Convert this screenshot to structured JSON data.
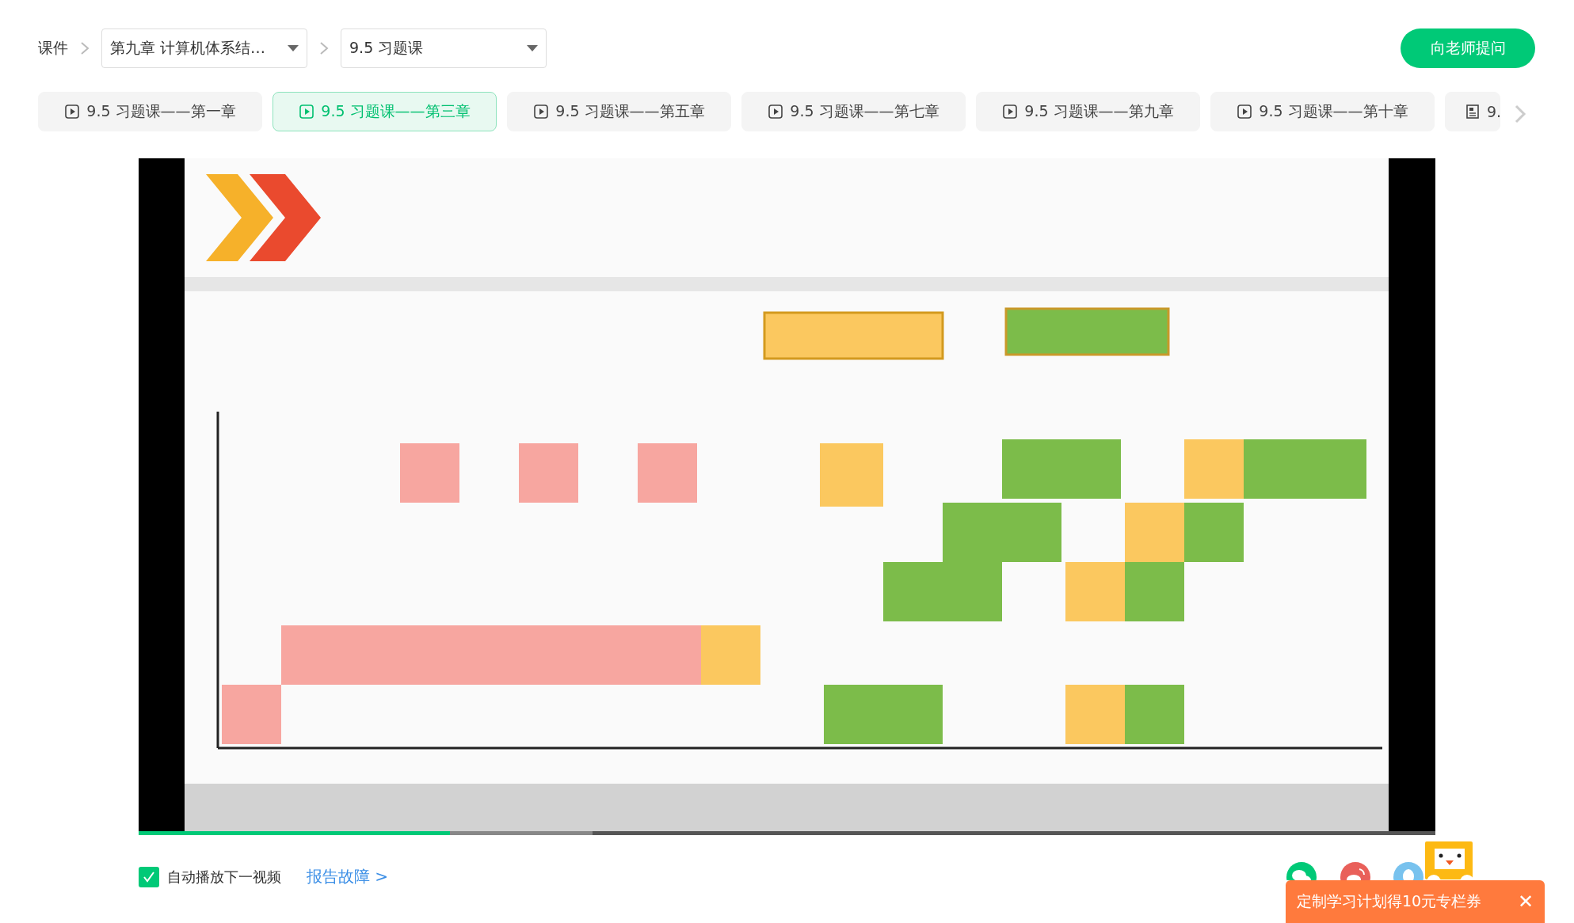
{
  "breadcrumb": {
    "root": "课件",
    "chapter": "第九章 计算机体系结…",
    "lesson": "9.5 习题课"
  },
  "ask_button": "向老师提问",
  "tabs": [
    {
      "label": "9.5 习题课——第一章",
      "kind": "video",
      "selected": false
    },
    {
      "label": "9.5 习题课——第三章",
      "kind": "video",
      "selected": true
    },
    {
      "label": "9.5 习题课——第五章",
      "kind": "video",
      "selected": false
    },
    {
      "label": "9.5 习题课——第七章",
      "kind": "video",
      "selected": false
    },
    {
      "label": "9.5 习题课——第九章",
      "kind": "video",
      "selected": false
    },
    {
      "label": "9.5 习题课——第十章",
      "kind": "video",
      "selected": false
    },
    {
      "label": "9.",
      "kind": "document",
      "selected": false
    }
  ],
  "player": {
    "kind": "picture",
    "progress": {
      "level": 0.24
    }
  },
  "autoplay": {
    "label": "自动播放下一视频",
    "checked": true
  },
  "report_link": "报告故障 >",
  "promo": {
    "text": "定制学习计划得10元专栏券",
    "close": "✕"
  }
}
